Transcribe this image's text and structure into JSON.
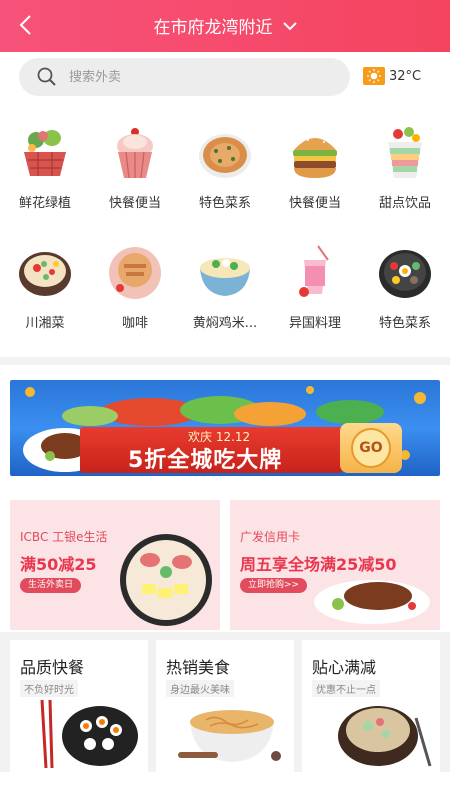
{
  "header": {
    "location": "在市府龙湾附近",
    "back_icon": "back-icon",
    "dropdown_icon": "chevron-down-icon",
    "color": "#f4445f"
  },
  "search": {
    "placeholder": "搜索外卖"
  },
  "weather": {
    "temperature": "32°C",
    "icon": "sun-icon"
  },
  "categories": [
    {
      "label": "鲜花绿植",
      "icon": "flower-basket-icon"
    },
    {
      "label": "快餐便当",
      "icon": "cupcake-icon"
    },
    {
      "label": "特色菜系",
      "icon": "pancake-icon"
    },
    {
      "label": "快餐便当",
      "icon": "burger-icon"
    },
    {
      "label": "甜点饮品",
      "icon": "dessert-cup-icon"
    },
    {
      "label": "川湘菜",
      "icon": "hotpot-icon"
    },
    {
      "label": "咖啡",
      "icon": "coffee-icon"
    },
    {
      "label": "黄焖鸡米...",
      "icon": "noodle-bowl-icon"
    },
    {
      "label": "异国料理",
      "icon": "drink-icon"
    },
    {
      "label": "特色菜系",
      "icon": "bibimbap-icon"
    }
  ],
  "banner": {
    "top_text": "欢庆 12.12",
    "main_text": "5折全城吃大牌",
    "button": "GO"
  },
  "promos": [
    {
      "subtitle": "ICBC 工银e生活",
      "title": "满50减25",
      "tag": "生活外卖日"
    },
    {
      "subtitle": "广发信用卡",
      "title": "周五享全场满25减50",
      "tag": "立即抢购>>"
    }
  ],
  "features": [
    {
      "title": "品质快餐",
      "sub": "不负好时光"
    },
    {
      "title": "热销美食",
      "sub": "身边最火美味"
    },
    {
      "title": "贴心满减",
      "sub": "优惠不止一点"
    }
  ]
}
